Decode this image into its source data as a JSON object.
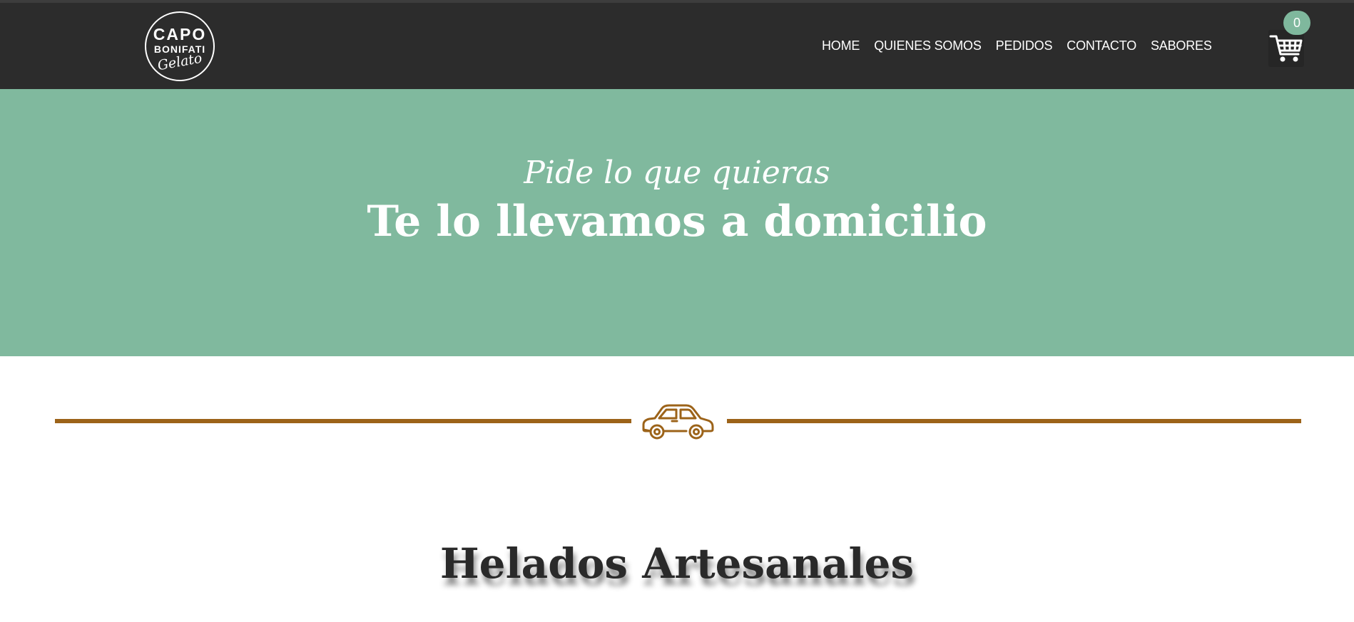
{
  "header": {
    "logo": {
      "line1": "CAPO",
      "line2": "BONIFATI",
      "line3": "Gelato"
    },
    "nav": [
      "HOME",
      "QUIENES SOMOS",
      "PEDIDOS",
      "CONTACTO",
      "SABORES"
    ],
    "cart": {
      "icon": "shopping-cart-icon",
      "count": "0"
    }
  },
  "hero": {
    "script_line": "Pide lo que quieras",
    "headline": "Te lo llevamos a domicilio"
  },
  "divider": {
    "icon": "car-icon"
  },
  "section": {
    "title": "Helados Artesanales"
  },
  "colors": {
    "header_bg": "#2c2c2c",
    "hero_bg": "#80b99e",
    "accent_brown": "#9c6319",
    "badge_bg": "#7fb89d",
    "title_text": "#2a2a2a"
  }
}
